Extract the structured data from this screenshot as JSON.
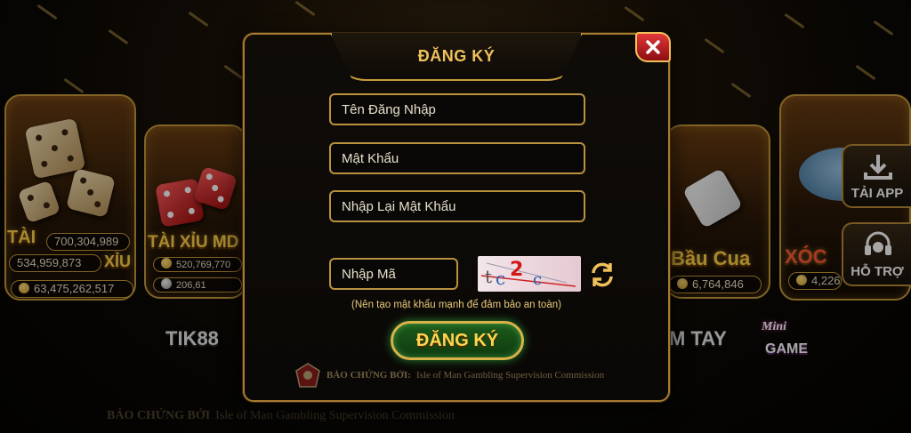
{
  "background": {
    "cards": {
      "taixiu": {
        "title_left": "TÀI",
        "title_right": "XỈU",
        "jackpot_1": "700,304,989",
        "jackpot_2": "534,959,873",
        "total": "63,475,262,517"
      },
      "taixiu_md5": {
        "title": "TÀI XỈU MD",
        "value_1": "520,769,770",
        "value_2": "206,61"
      },
      "baucua": {
        "title": "Bầu Cua",
        "value": "6,764,846"
      },
      "xocdia": {
        "title": "XÓC",
        "value": "4,226"
      }
    },
    "labels": {
      "tik88": "TIK88",
      "mtay": "M TAY",
      "mini_game_line1": "Mini",
      "mini_game_line2": "GAME"
    },
    "footer_witness": "BẢO CHỨNG BỞI",
    "footer_commission": "Isle of Man Gambling Supervision Commission"
  },
  "sidebar": {
    "download_label": "TẢI APP",
    "support_label": "HỖ TRỢ"
  },
  "modal": {
    "title": "ĐĂNG KÝ",
    "username_placeholder": "Tên Đăng Nhập",
    "password_placeholder": "Mật Khẩu",
    "confirm_password_placeholder": "Nhập Lại Mật Khẩu",
    "captcha_placeholder": "Nhập Mã",
    "captcha_text": "tc2c",
    "hint": "(Nên tạo mật khẩu mạnh để đảm bảo an toàn)",
    "submit_label": "ĐĂNG KÝ",
    "witness_label": "BẢO CHỨNG BỞI:",
    "witness_org": "Isle of Man Gambling Supervision Commission"
  },
  "colors": {
    "gold": "#f0c15a",
    "close_red": "#c8202a",
    "submit_green": "#1c5a1a",
    "field_border": "#b9913f"
  }
}
